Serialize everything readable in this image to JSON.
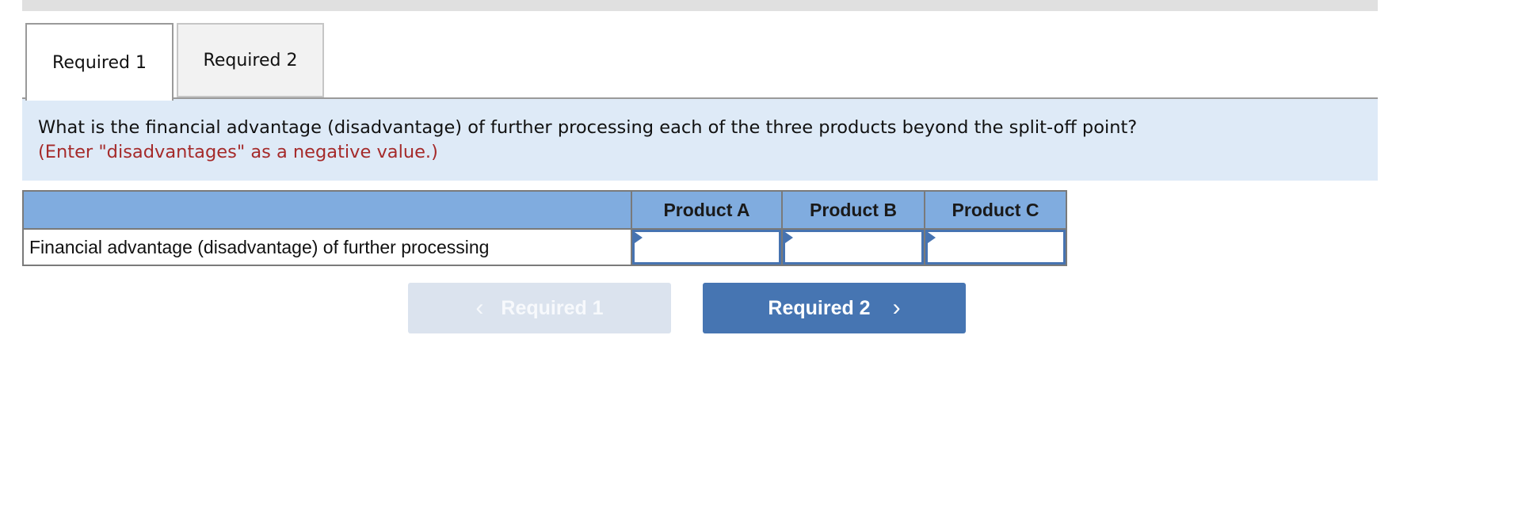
{
  "tabs": [
    {
      "label": "Required 1",
      "active": true
    },
    {
      "label": "Required 2",
      "active": false
    }
  ],
  "question": {
    "text": "What is the financial advantage (disadvantage) of further processing each of the three products beyond the split-off point?",
    "note": "(Enter \"disadvantages\" as a negative value.)"
  },
  "table": {
    "headers": [
      "",
      "Product A",
      "Product B",
      "Product C"
    ],
    "rows": [
      {
        "label": "Financial advantage (disadvantage) of further processing",
        "values": [
          "",
          "",
          ""
        ]
      }
    ]
  },
  "navigation": {
    "prev": {
      "label": "Required 1",
      "icon": "chevron-left-icon",
      "enabled": false
    },
    "next": {
      "label": "Required 2",
      "icon": "chevron-right-icon",
      "enabled": true
    }
  },
  "colors": {
    "accent": "#4675b2",
    "header_bg": "#80acdf",
    "question_bg": "#deeaf7",
    "note_text": "#a52a2a"
  }
}
